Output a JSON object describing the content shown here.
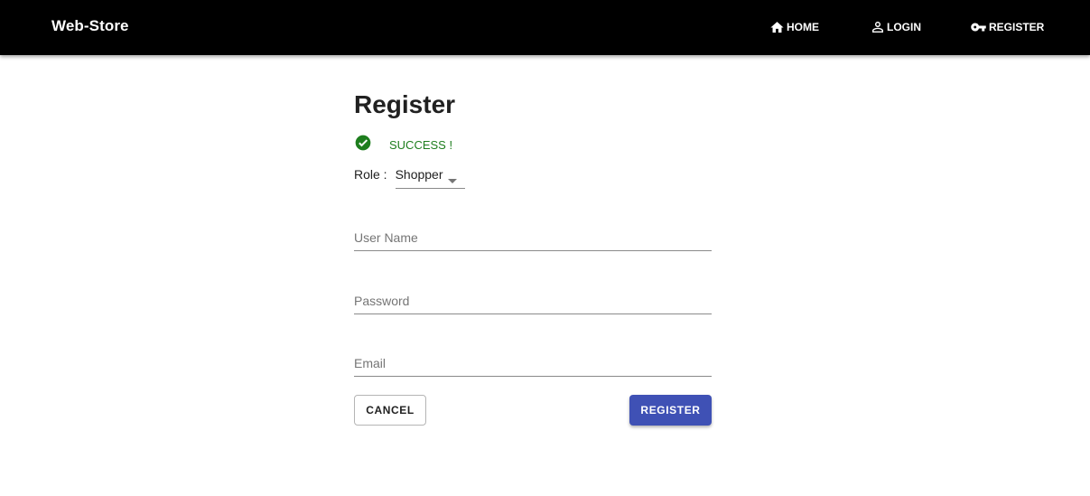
{
  "header": {
    "brand": "Web-Store",
    "nav": {
      "home": {
        "label": "HOME",
        "icon": "home-icon"
      },
      "login": {
        "label": "LOGIN",
        "icon": "person-icon"
      },
      "register": {
        "label": "REGISTER",
        "icon": "key-icon"
      }
    }
  },
  "form": {
    "title": "Register",
    "status": {
      "text": "SUCCESS !",
      "icon": "check-circle-icon",
      "color": "#1e7e1e"
    },
    "role": {
      "label": "Role :",
      "selected": "Shopper"
    },
    "username": {
      "placeholder": "User Name",
      "value": ""
    },
    "password": {
      "placeholder": "Password",
      "value": ""
    },
    "email": {
      "placeholder": "Email",
      "value": ""
    },
    "cancel_label": "CANCEL",
    "register_label": "REGISTER"
  },
  "colors": {
    "topbar": "#000000",
    "primary": "#3f51b5",
    "success": "#1e7e1e"
  }
}
